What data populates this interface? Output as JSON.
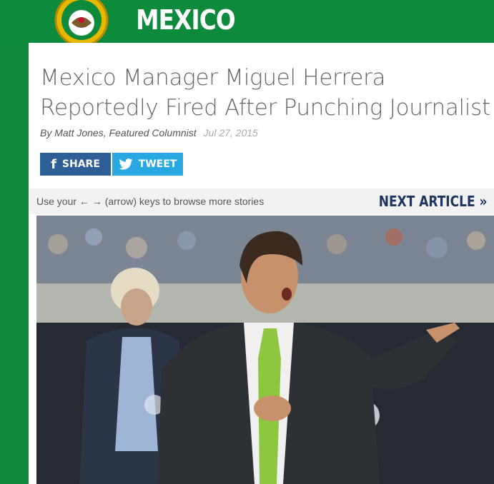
{
  "header": {
    "team_name": "MEXICO",
    "crest_icon": "mexico-crest-icon"
  },
  "article": {
    "title": "Mexico Manager Miguel Herrera Reportedly Fired After Punching Journalist",
    "author": "By Matt Jones, Featured Columnist",
    "date": "Jul 27, 2015"
  },
  "share": {
    "facebook_icon": "facebook-icon",
    "facebook_label": "SHARE",
    "twitter_icon": "twitter-icon",
    "twitter_label": "TWEET"
  },
  "browse": {
    "hint": "Use your ← → (arrow) keys to browse more stories",
    "next_label": "NEXT ARTICLE »"
  },
  "colors": {
    "brand_green": "#0d8a3b",
    "facebook_blue": "#2d5e96",
    "twitter_blue": "#27a8e0",
    "next_link_navy": "#1b3560"
  }
}
